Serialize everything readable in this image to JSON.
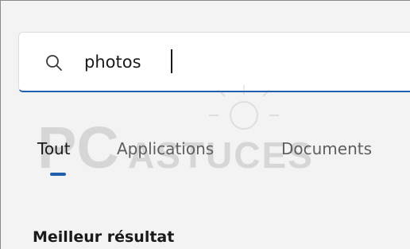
{
  "search": {
    "value": "photos",
    "icon": "search-icon"
  },
  "tabs": [
    {
      "label": "Tout",
      "active": true
    },
    {
      "label": "Applications",
      "active": false
    },
    {
      "label": "Documents",
      "active": false
    }
  ],
  "section": {
    "title": "Meilleur résultat"
  },
  "watermark": {
    "text": "PCASTUCES"
  },
  "colors": {
    "accent": "#1f5fb0",
    "background": "#f3f3f3",
    "input_background": "#ffffff"
  }
}
